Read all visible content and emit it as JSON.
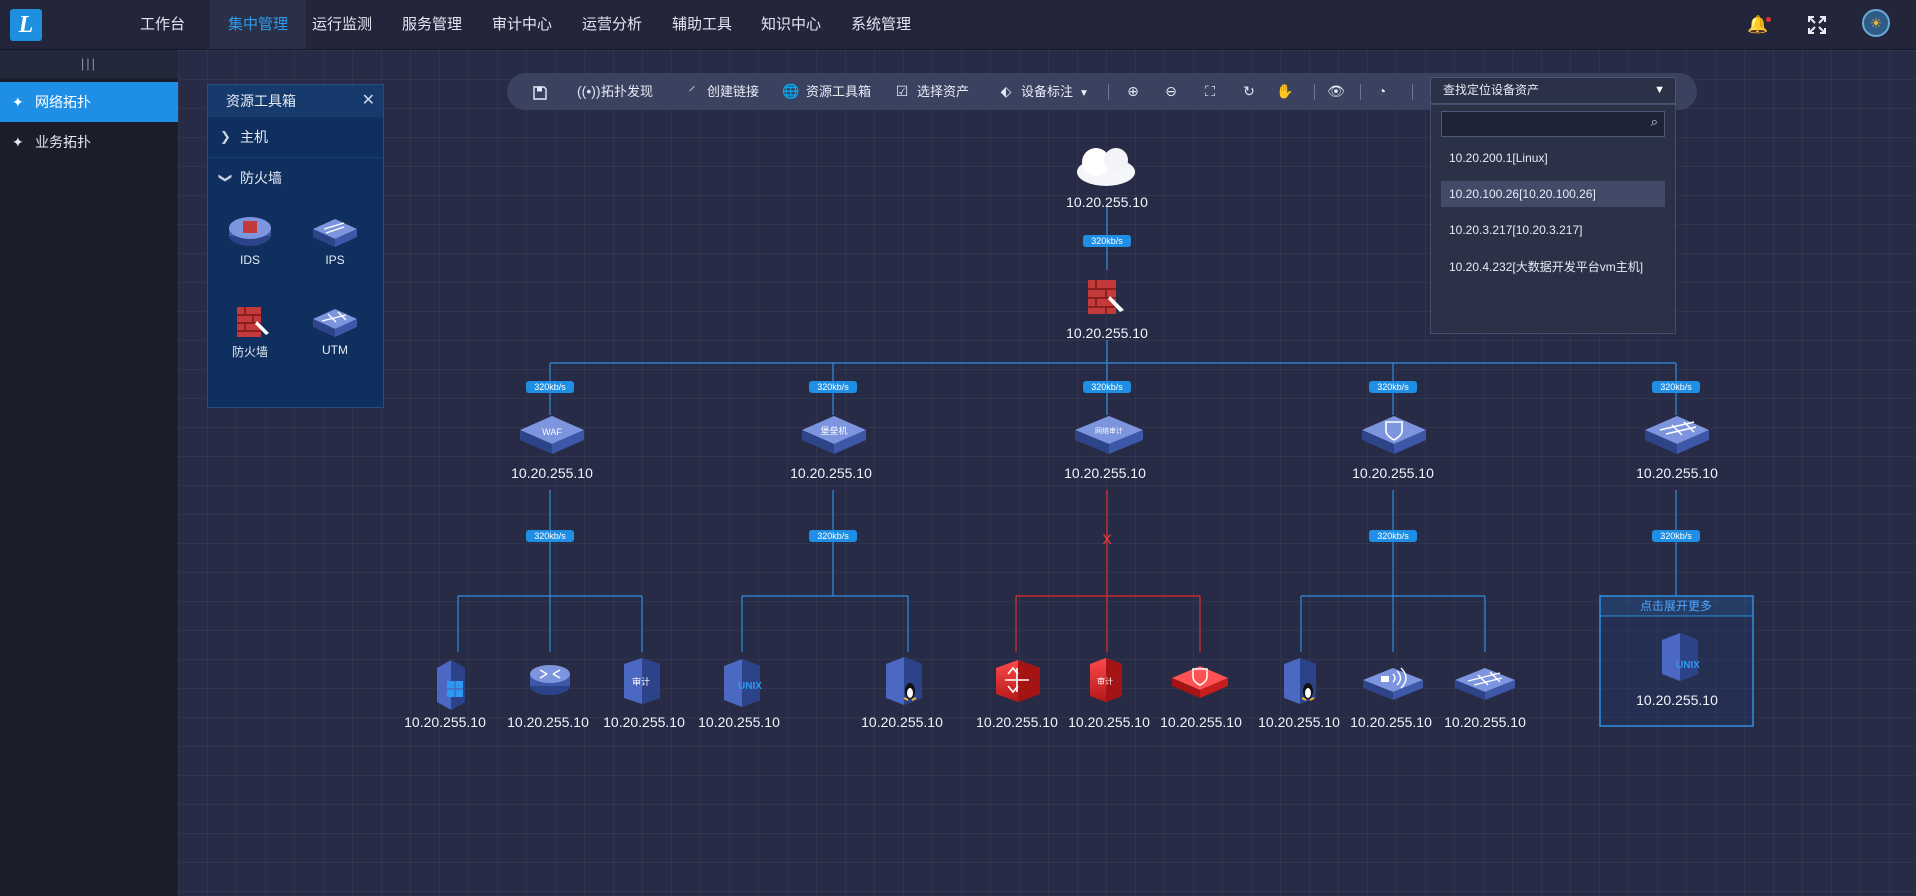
{
  "app": {
    "logo_letter": "L"
  },
  "nav": [
    {
      "label": "工作台",
      "active": false
    },
    {
      "label": "集中管理",
      "active": true
    },
    {
      "label": "运行监测",
      "active": false
    },
    {
      "label": "服务管理",
      "active": false
    },
    {
      "label": "审计中心",
      "active": false
    },
    {
      "label": "运营分析",
      "active": false
    },
    {
      "label": "辅助工具",
      "active": false
    },
    {
      "label": "知识中心",
      "active": false
    },
    {
      "label": "系统管理",
      "active": false
    }
  ],
  "sidebar": {
    "collapse_glyph": "|||",
    "items": [
      {
        "label": "网络拓扑",
        "active": true
      },
      {
        "label": "业务拓扑",
        "active": false
      }
    ]
  },
  "toolbox": {
    "title": "资源工具箱",
    "categories": [
      {
        "label": "主机",
        "expanded": false
      },
      {
        "label": "防火墙",
        "expanded": true
      }
    ],
    "items": [
      {
        "label": "IDS",
        "icon": "ids-icon"
      },
      {
        "label": "IPS",
        "icon": "ips-icon"
      },
      {
        "label": "防火墙",
        "icon": "firewall-icon"
      },
      {
        "label": "UTM",
        "icon": "utm-icon"
      }
    ]
  },
  "toolbar": {
    "discover": "拓扑发现",
    "create_link": "创建链接",
    "resource_toolbox": "资源工具箱",
    "select_asset": "选择资产",
    "device_label": "设备标注",
    "find_placeholder": "查找定位设备资产"
  },
  "dropdown": {
    "options": [
      "10.20.200.1[Linux]",
      "10.20.100.26[10.20.100.26]",
      "10.20.3.217[10.20.3.217]",
      "10.20.4.232[大数据开发平台vm主机]"
    ],
    "hover_index": 1
  },
  "topology": {
    "bandwidth": "320kb/s",
    "node_ip": "10.20.255.10",
    "expand_more": "点击展开更多",
    "broken_marker": "X",
    "l2_icon_text": [
      "WAF",
      "堡垒机",
      "网络审计",
      "",
      ""
    ],
    "leaf_text": {
      "audit": "审计",
      "unix": "UNIX"
    }
  },
  "colors": {
    "accent": "#1f8fe6",
    "link": "#2f8ee0",
    "alarm": "#e02b2b",
    "device": "#3d5cae"
  }
}
